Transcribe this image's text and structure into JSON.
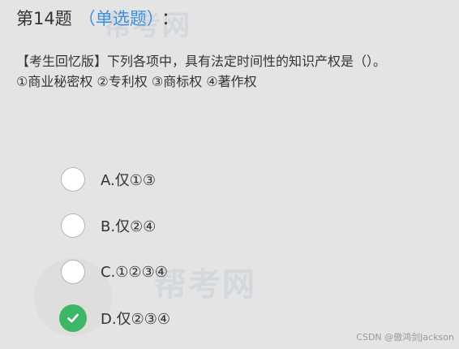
{
  "watermark": {
    "top": "帮考网",
    "middle": "帮考网"
  },
  "question": {
    "number": "第14题",
    "type": "（单选题）",
    "colon": "：",
    "stem_line1": "【考生回忆版】下列各项中，具有法定时间性的知识产权是（）。",
    "stem_line2": "①商业秘密权 ②专利权 ③商标权 ④著作权"
  },
  "options": [
    {
      "label": "A.仅①③",
      "checked": false
    },
    {
      "label": "B.仅②④",
      "checked": false
    },
    {
      "label": "C.①②③④",
      "checked": false
    },
    {
      "label": "D.仅②③④",
      "checked": true
    }
  ],
  "footer": {
    "text": "CSDN @傲鸿剑Jackson"
  },
  "colors": {
    "background": "#e4e4e4",
    "question_type": "#3d8fe0",
    "checked": "#3cb767"
  },
  "icons": {
    "checked_option": "check-icon"
  }
}
